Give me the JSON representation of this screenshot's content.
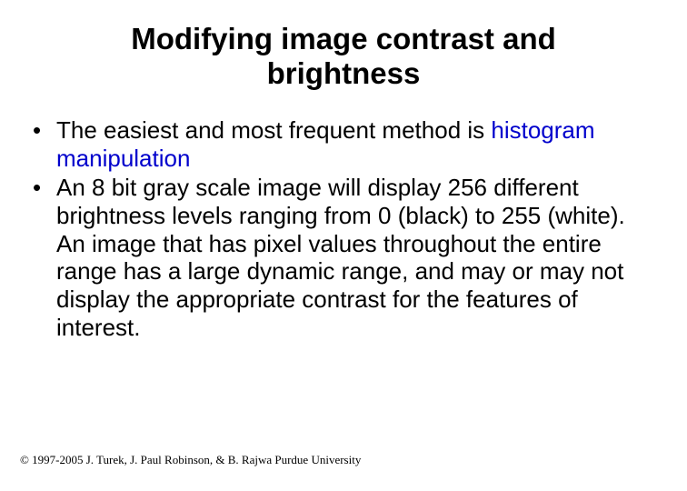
{
  "title": "Modifying image contrast and brightness",
  "bullets": [
    {
      "pre": "The easiest and most frequent method is ",
      "highlight": "histogram manipulation",
      "post": ""
    },
    {
      "pre": "An 8 bit gray scale image will display 256 different brightness levels ranging from 0 (black) to 255 (white).  An image that has pixel values throughout the entire range has a large dynamic range, and may or may not display the appropriate contrast for the features of interest.",
      "highlight": "",
      "post": ""
    }
  ],
  "footer": "© 1997-2005 J. Turek, J. Paul Robinson, & B. Rajwa Purdue University"
}
